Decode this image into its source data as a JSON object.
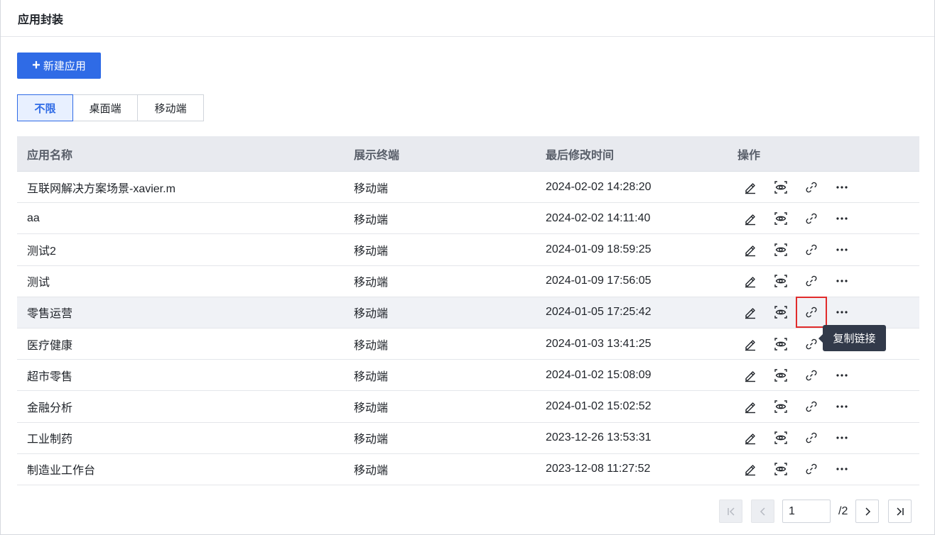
{
  "header": {
    "title": "应用封装"
  },
  "toolbar": {
    "new_label": "新建应用"
  },
  "filters": [
    {
      "label": "不限",
      "active": true
    },
    {
      "label": "桌面端",
      "active": false
    },
    {
      "label": "移动端",
      "active": false
    }
  ],
  "table": {
    "columns": [
      "应用名称",
      "展示终端",
      "最后修改时间",
      "操作"
    ],
    "rows": [
      {
        "name": "互联网解决方案场景-xavier.m",
        "terminal": "移动端",
        "modified": "2024-02-02 14:28:20"
      },
      {
        "name": "aa",
        "terminal": "移动端",
        "modified": "2024-02-02 14:11:40"
      },
      {
        "name": "测试2",
        "terminal": "移动端",
        "modified": "2024-01-09 18:59:25"
      },
      {
        "name": "测试",
        "terminal": "移动端",
        "modified": "2024-01-09 17:56:05"
      },
      {
        "name": "零售运营",
        "terminal": "移动端",
        "modified": "2024-01-05 17:25:42"
      },
      {
        "name": "医疗健康",
        "terminal": "移动端",
        "modified": "2024-01-03 13:41:25"
      },
      {
        "name": "超市零售",
        "terminal": "移动端",
        "modified": "2024-01-02 15:08:09"
      },
      {
        "name": "金融分析",
        "terminal": "移动端",
        "modified": "2024-01-02 15:02:52"
      },
      {
        "name": "工业制药",
        "terminal": "移动端",
        "modified": "2023-12-26 13:53:31"
      },
      {
        "name": "制造业工作台",
        "terminal": "移动端",
        "modified": "2023-12-08 11:27:52"
      }
    ],
    "row_icons": [
      "edit-icon",
      "preview-eye-icon",
      "link-icon",
      "more-icon"
    ]
  },
  "tooltip": {
    "text": "复制链接"
  },
  "pagination": {
    "current": "1",
    "total": "/2"
  },
  "colors": {
    "primary": "#2f6be6",
    "highlight_box": "#e12b2b",
    "tooltip_bg": "#323a4a"
  }
}
